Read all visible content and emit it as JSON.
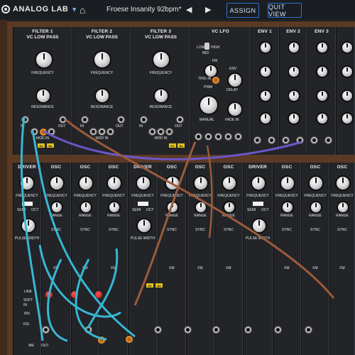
{
  "header": {
    "logo_text": "ANALOG LAB",
    "preset_name": "Froese Insanity 92bpm*",
    "prev_symbol": "◀",
    "next_symbol": "▶",
    "assign_label": "ASSIGN",
    "quit_view_label": "QUIT VIEW"
  },
  "top_modules": {
    "filter1": {
      "title": "FILTER 1",
      "subtitle": "VC LOW PASS",
      "frequency": "FREQUENCY",
      "resonance": "RESONANCE",
      "in": "IN",
      "out": "OUT",
      "modin": "MOD IN"
    },
    "filter2": {
      "title": "FILTER 2",
      "subtitle": "VC LOW PASS",
      "frequency": "FREQUENCY",
      "resonance": "RESONANCE",
      "in": "IN",
      "out": "OUT",
      "modin": "MOD IN"
    },
    "filter3": {
      "title": "FILTER 3",
      "subtitle": "VC LOW PASS",
      "frequency": "FREQUENCY",
      "resonance": "RESONANCE",
      "in": "IN",
      "out": "OUT",
      "modin": "MOD IN"
    },
    "vclfo": {
      "title": "VC LFO",
      "low": "LOW",
      "mid": "MID",
      "high": "HIGH",
      "fm": "FM",
      "trig_in": "TRIG IN",
      "pwm": "PWM",
      "manual": "MANUAL",
      "env": "ENV",
      "delay": "DELAY",
      "fade_in": "FADE IN"
    },
    "env": [
      {
        "title": "ENV 1"
      },
      {
        "title": "ENV 2"
      },
      {
        "title": "ENV 3"
      }
    ],
    "k1": "K1",
    "no": "No"
  },
  "bottom_modules": [
    {
      "title": "DRIVER",
      "frequency": "FREQUENCY",
      "semi": "SEMI",
      "oct": "OCT",
      "pulse_width": "PULSE WIDTH"
    },
    {
      "title": "OSC",
      "frequency": "FREQUENCY",
      "range": "RANGE",
      "sync": "SYNC",
      "fm": "FM"
    },
    {
      "title": "OSC",
      "frequency": "FREQUENCY",
      "range": "RANGE",
      "sync": "SYNC",
      "fm": "FM"
    },
    {
      "title": "OSC",
      "frequency": "FREQUENCY",
      "range": "RANGE",
      "sync": "SYNC",
      "fm": "FM"
    },
    {
      "title": "DRIVER",
      "frequency": "FREQUENCY",
      "semi": "SEMI",
      "oct": "OCT",
      "pulse_width": "PULSE WIDTH"
    },
    {
      "title": "OSC",
      "frequency": "FREQUENCY",
      "range": "RANGE",
      "sync": "SYNC",
      "fm": "FM"
    },
    {
      "title": "OSC",
      "frequency": "FREQUENCY",
      "range": "RANGE",
      "sync": "SYNC",
      "fm": "FM"
    },
    {
      "title": "OSC",
      "frequency": "FREQUENCY",
      "range": "RANGE",
      "sync": "SYNC",
      "fm": "FM"
    },
    {
      "title": "DRIVER",
      "frequency": "FREQUENCY",
      "semi": "SEMI",
      "oct": "OCT",
      "pulse_width": "PULSE WIDTH"
    },
    {
      "title": "OSC",
      "frequency": "FREQUENCY",
      "range": "RANGE",
      "sync": "SYNC",
      "fm": "FM"
    },
    {
      "title": "OSC",
      "frequency": "FREQUENCY",
      "range": "RANGE",
      "sync": "SYNC",
      "fm": "FM"
    },
    {
      "title": "OSC",
      "frequency": "FREQUENCY",
      "range": "RANGE",
      "sync": "SYNC",
      "fm": "FM"
    }
  ],
  "bottom_rows": {
    "link": "LINK",
    "soft_sync": "SOFT",
    "in": "IN",
    "inv": "INV",
    "vol": "VOL",
    "am": "AM",
    "out": "OUT"
  },
  "colors": {
    "accent": "#2a72c9",
    "cable_cyan": "#36b7d3",
    "cable_brown": "#9b5b3b",
    "cable_purple": "#6d56c9",
    "wood": "#5a3a24"
  }
}
